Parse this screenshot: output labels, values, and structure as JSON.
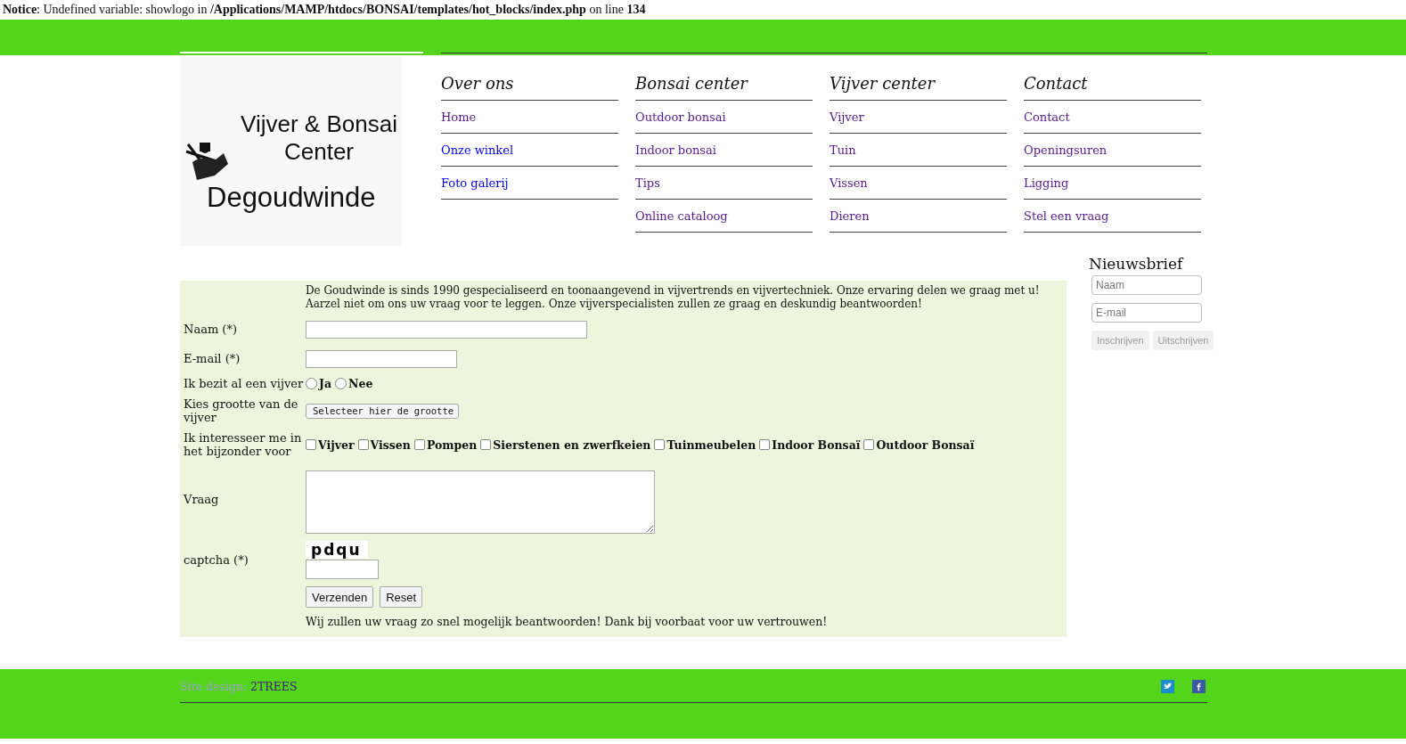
{
  "notice": {
    "label": "Notice",
    "text": ": Undefined variable: showlogo in ",
    "path": "/Applications/MAMP/htdocs/BONSAI/templates/hot_blocks/index.php",
    "after": " on line ",
    "line": "134"
  },
  "logo": {
    "title": "Vijver & Bonsai Center",
    "name": "Degoudwinde"
  },
  "menu": [
    {
      "heading": "Over ons",
      "links": [
        {
          "label": "Home",
          "visited": true
        },
        {
          "label": "Onze winkel",
          "visited": false
        },
        {
          "label": "Foto galerij",
          "visited": false
        }
      ]
    },
    {
      "heading": "Bonsai center",
      "links": [
        {
          "label": "Outdoor bonsai",
          "visited": true
        },
        {
          "label": "Indoor bonsai",
          "visited": true
        },
        {
          "label": "Tips",
          "visited": true
        },
        {
          "label": "Online cataloog",
          "visited": true
        }
      ]
    },
    {
      "heading": "Vijver center",
      "links": [
        {
          "label": "Vijver",
          "visited": true
        },
        {
          "label": "Tuin",
          "visited": true
        },
        {
          "label": "Vissen",
          "visited": true
        },
        {
          "label": "Dieren",
          "visited": true
        }
      ]
    },
    {
      "heading": "Contact",
      "links": [
        {
          "label": "Contact",
          "visited": true
        },
        {
          "label": "Openingsuren",
          "visited": true
        },
        {
          "label": "Ligging",
          "visited": true
        },
        {
          "label": "Stel een vraag",
          "visited": true
        }
      ]
    }
  ],
  "form": {
    "intro": "De Goudwinde is sinds 1990 gespecialiseerd en toonaangevend in vijvertrends en vijvertechniek. Onze ervaring delen we graag met u! Aarzel niet om ons uw vraag voor te leggen. Onze vijverspecialisten zullen ze graag en deskundig beantwoorden!",
    "rows": [
      {
        "kind": "text",
        "label": "Naam (*)"
      },
      {
        "kind": "text",
        "label": "E-mail (*)"
      },
      {
        "kind": "radio",
        "label": "Ik bezit al een vijver",
        "options": [
          {
            "label": "Ja",
            "selected": false
          },
          {
            "label": "Nee",
            "selected": false
          }
        ]
      },
      {
        "kind": "select",
        "label": "Kies grootte van de vijver",
        "value": "Selecteer hier de grootte"
      },
      {
        "kind": "checkbox",
        "label": "Ik interesseer me in het bijzonder voor",
        "options": [
          {
            "label": "Vijver",
            "checked": false
          },
          {
            "label": "Vissen",
            "checked": false
          },
          {
            "label": "Pompen",
            "checked": false
          },
          {
            "label": "Sierstenen en zwerfkeien",
            "checked": false
          },
          {
            "label": "Tuinmeubelen",
            "checked": false
          },
          {
            "label": "Indoor Bonsaï",
            "checked": false
          },
          {
            "label": "Outdoor Bonsaï",
            "checked": false
          }
        ]
      },
      {
        "kind": "textarea",
        "label": "Vraag"
      },
      {
        "kind": "captcha",
        "label": "captcha (*)",
        "code": "pdqu"
      }
    ],
    "buttons": [
      "Verzenden",
      "Reset"
    ],
    "footnote": "Wij zullen uw vraag zo snel mogelijk beantwoorden! Dank bij voorbaat voor uw vertrouwen!"
  },
  "newsletter": {
    "title": "Nieuwsbrief",
    "fields": [
      {
        "placeholder": "Naam"
      },
      {
        "placeholder": "E-mail"
      }
    ],
    "buttons": [
      {
        "label": "Inschrijven",
        "disabled": true
      },
      {
        "label": "Uitschrijven",
        "disabled": true
      }
    ]
  },
  "footer": {
    "credit": "Site design:",
    "designer": "2TREES"
  }
}
